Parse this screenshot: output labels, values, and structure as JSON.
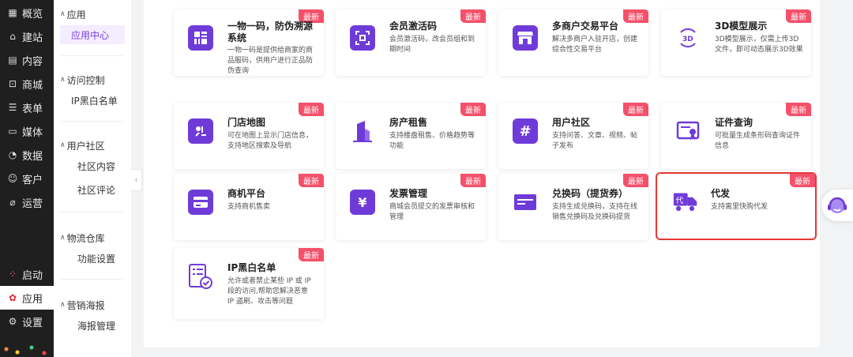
{
  "nav": {
    "items": [
      {
        "label": "概览",
        "icon": "grid-icon"
      },
      {
        "label": "建站",
        "icon": "home-icon"
      },
      {
        "label": "内容",
        "icon": "document-icon"
      },
      {
        "label": "商城",
        "icon": "cart-icon"
      },
      {
        "label": "表单",
        "icon": "form-icon"
      },
      {
        "label": "媒体",
        "icon": "video-icon"
      },
      {
        "label": "数据",
        "icon": "pie-chart-icon"
      },
      {
        "label": "客户",
        "icon": "user-icon"
      },
      {
        "label": "运营",
        "icon": "link-icon"
      }
    ],
    "bottom": [
      {
        "label": "启动",
        "icon": "dots-icon"
      },
      {
        "label": "应用",
        "icon": "flower-icon"
      },
      {
        "label": "设置",
        "icon": "gear-icon"
      }
    ]
  },
  "submenu": {
    "groups": [
      {
        "title": "应用",
        "items": [
          "应用中心"
        ]
      },
      {
        "title": "访问控制",
        "items": [
          "IP黑白名单"
        ]
      },
      {
        "title": "用户社区",
        "items": [
          "社区内容",
          "社区评论"
        ]
      },
      {
        "title": "物流仓库",
        "items": [
          "功能设置"
        ]
      },
      {
        "title": "营销海报",
        "items": [
          "海报管理"
        ]
      }
    ]
  },
  "badge_label": "最新",
  "cards": [
    {
      "title": "一物一码，防伪溯源系统",
      "desc": "一物一码是提供给商家的商品服码，供用户进行正品防伪查询",
      "icon": "qrcode-icon"
    },
    {
      "title": "会员激活码",
      "desc": "会员激活码，改会员组和到期时间",
      "icon": "scan-icon"
    },
    {
      "title": "多商户交易平台",
      "desc": "解决多商户入驻开店，创建综合性交易平台",
      "icon": "store-icon"
    },
    {
      "title": "3D模型展示",
      "desc": "3D模型展示，仅需上传3D文件，即可动态展示3D效果",
      "icon": "3d-icon"
    },
    {
      "title": "门店地图",
      "desc": "可在地图上显示门店信息，支持地区搜索及导航",
      "icon": "map-icon"
    },
    {
      "title": "房产租售",
      "desc": "支持楼盘租售、价格趋势等功能",
      "icon": "building-icon"
    },
    {
      "title": "用户社区",
      "desc": "支持问答、文章、视频、帖子发布",
      "icon": "hashtag-icon"
    },
    {
      "title": "证件查询",
      "desc": "可批量生成条形码查询证件信息",
      "icon": "certificate-icon"
    },
    {
      "title": "商机平台",
      "desc": "支持商机售卖",
      "icon": "card-icon"
    },
    {
      "title": "发票管理",
      "desc": "商城会员提交的发票审核和管理",
      "icon": "invoice-icon"
    },
    {
      "title": "兑换码（提货券）",
      "desc": "支持生成兑换码，支持在线销售兑换码及兑换码提货",
      "icon": "voucher-icon"
    },
    {
      "title": "代发",
      "desc": "支持离里快购代发",
      "icon": "truck-icon"
    },
    {
      "title": "IP黑白名单",
      "desc": "允许或者禁止某些 IP 或 IP 段的访问,帮助您解决恶意 IP 盗刷、攻击等问题",
      "icon": "checklist-icon"
    }
  ],
  "colors": {
    "accent": "#6f3bd8",
    "badge": "#f4506a",
    "highlight": "#e53935"
  }
}
